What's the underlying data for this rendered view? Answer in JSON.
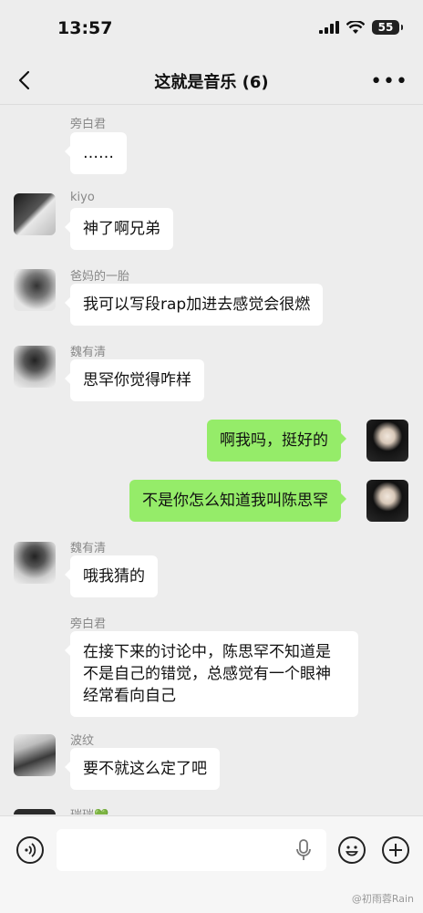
{
  "status": {
    "time": "13:57",
    "battery": "55"
  },
  "nav": {
    "title": "这就是音乐 (6)"
  },
  "messages": [
    {
      "sender": "旁白君",
      "text": "……"
    },
    {
      "sender": "kiyo",
      "text": "神了啊兄弟"
    },
    {
      "sender": "爸妈的一胎",
      "text": "我可以写段rap加进去感觉会很燃"
    },
    {
      "sender": "魏有清",
      "text": "思罕你觉得咋样"
    },
    {
      "sender": "",
      "text": "啊我吗，挺好的"
    },
    {
      "sender": "",
      "text": "不是你怎么知道我叫陈思罕"
    },
    {
      "sender": "魏有清",
      "text": "哦我猜的"
    },
    {
      "sender": "旁白君",
      "text": "在接下来的讨论中，陈思罕不知道是不是自己的错觉，总感觉有一个眼神经常看向自己"
    },
    {
      "sender": "波纹",
      "text": "要不就这么定了吧"
    },
    {
      "sender": "瑞瑞💚",
      "text": ""
    }
  ],
  "watermark": "@初雨蓉Rain",
  "colors": {
    "green_bubble": "#95ec69",
    "background": "#ededed"
  }
}
